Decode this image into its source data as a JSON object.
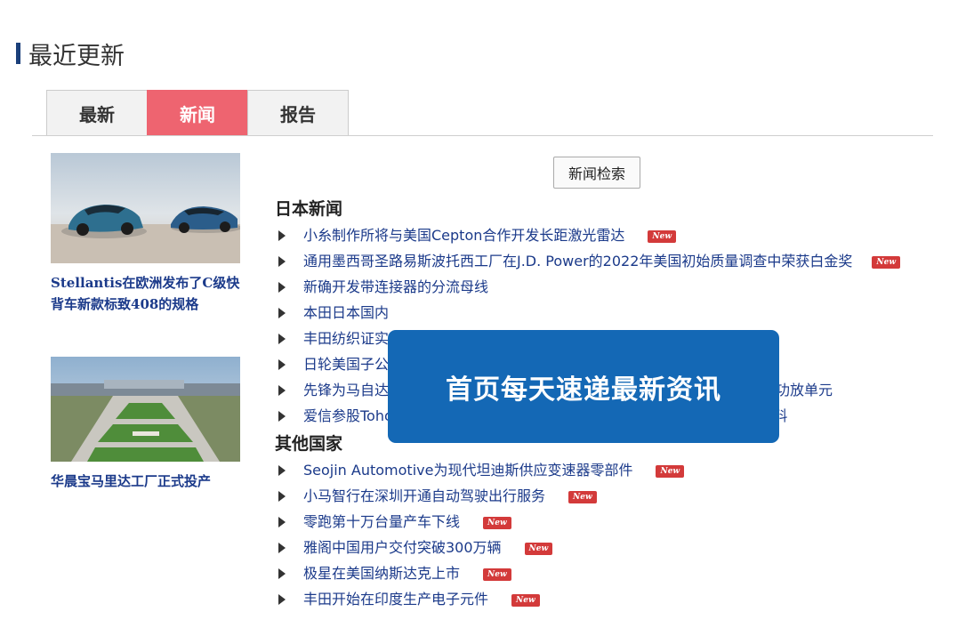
{
  "section": {
    "title": "最近更新"
  },
  "tabs": [
    {
      "label": "最新",
      "active": false
    },
    {
      "label": "新闻",
      "active": true
    },
    {
      "label": "报告",
      "active": false
    }
  ],
  "cards": [
    {
      "caption": "Stellantis在欧洲发布了C级快背车新款标致408的规格"
    },
    {
      "caption": "华晨宝马里达工厂正式投产"
    }
  ],
  "search_button": "新闻检索",
  "groups": [
    {
      "heading": "日本新闻",
      "items": [
        {
          "text": "小糸制作所将与美国Cepton合作开发长距激光雷达",
          "new": true
        },
        {
          "text": "通用墨西哥圣路易斯波托西工厂在J.D. Power的2022年美国初始质量调查中荣获白金奖",
          "new": true
        },
        {
          "text": "新确开发带连接器的分流母线",
          "new": false
        },
        {
          "text": "本田日本国内",
          "new": false
        },
        {
          "text": "丰田纺织证实",
          "new": false
        },
        {
          "text": "日轮美国子公",
          "new": false
        },
        {
          "text": "先锋为马自达",
          "tail": "功放单元",
          "new": false
        },
        {
          "text": "爱信参股Tohoku Magnet Institute，将合作开发电动车电机铁芯纳米晶材料",
          "new": false
        }
      ]
    },
    {
      "heading": "其他国家",
      "items": [
        {
          "text": "Seojin Automotive为现代坦迪斯供应变速器零部件",
          "new": true
        },
        {
          "text": "小马智行在深圳开通自动驾驶出行服务",
          "new": true
        },
        {
          "text": "零跑第十万台量产车下线",
          "new": true
        },
        {
          "text": "雅阁中国用户交付突破300万辆",
          "new": true
        },
        {
          "text": "极星在美国纳斯达克上市",
          "new": true
        },
        {
          "text": "丰田开始在印度生产电子元件",
          "new": true
        }
      ]
    }
  ],
  "badge_label": "New",
  "overlay": {
    "text": "首页每天速递最新资讯"
  },
  "colors": {
    "accent": "#ee6470",
    "link": "#1b3a8a",
    "overlay": "#1468b5",
    "badge": "#d33a3a"
  }
}
